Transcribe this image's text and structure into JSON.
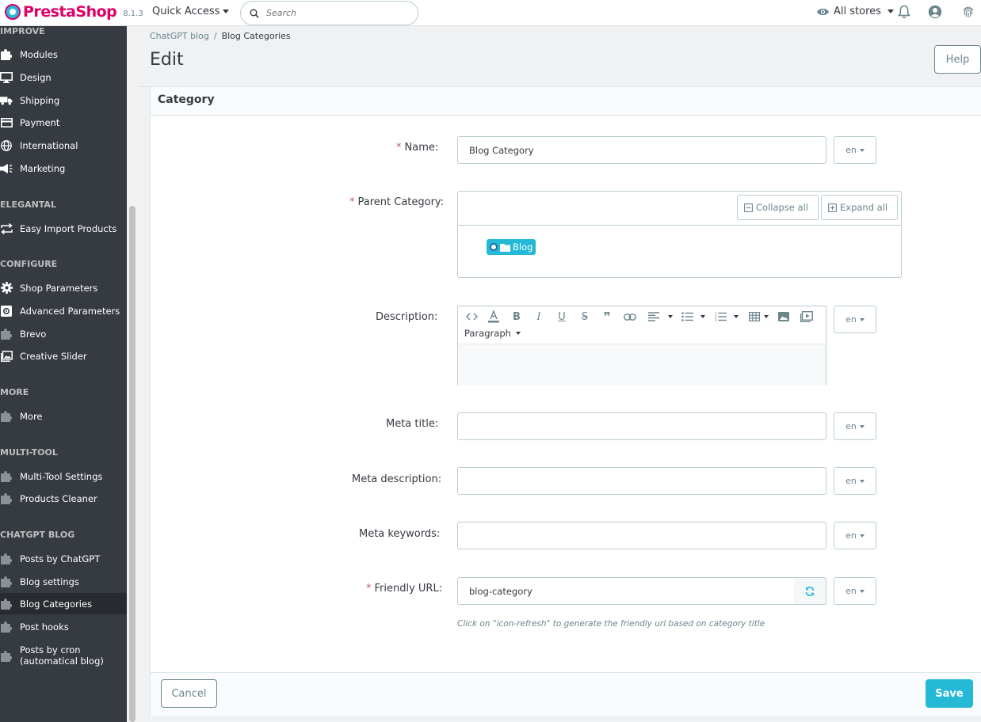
{
  "header": {
    "logo_text": "PrestaShop",
    "version": "8.1.3",
    "quick_access": "Quick Access",
    "search_placeholder": "Search",
    "all_stores": "All stores"
  },
  "sidebar": {
    "sections": {
      "improve": "IMPROVE",
      "elegantal": "ELEGANTAL",
      "configure": "CONFIGURE",
      "more": "MORE",
      "multitool": "MULTI-TOOL",
      "chatgpt": "CHATGPT BLOG"
    },
    "items": {
      "modules": "Modules",
      "design": "Design",
      "shipping": "Shipping",
      "payment": "Payment",
      "international": "International",
      "marketing": "Marketing",
      "easy_import": "Easy Import Products",
      "shop_params": "Shop Parameters",
      "advanced_params": "Advanced Parameters",
      "brevo": "Brevo",
      "creative_slider": "Creative Slider",
      "more": "More",
      "multitool_settings": "Multi-Tool Settings",
      "products_cleaner": "Products Cleaner",
      "posts_by_chatgpt": "Posts by ChatGPT",
      "blog_settings": "Blog settings",
      "blog_categories": "Blog Categories",
      "post_hooks": "Post hooks",
      "posts_by_cron_1": "Posts by cron",
      "posts_by_cron_2": "(automatical blog)"
    }
  },
  "breadcrumb": {
    "parent": "ChatGPT blog",
    "separator": "/",
    "current": "Blog Categories"
  },
  "page_title": "Edit",
  "help_label": "Help",
  "panel_title": "Category",
  "form": {
    "required_mark": "*",
    "name_label": "Name:",
    "name_value": "Blog Category",
    "parent_label": "Parent Category:",
    "collapse_all": "Collapse all",
    "expand_all": "Expand all",
    "tree_node": "Blog",
    "description_label": "Description:",
    "paragraph": "Paragraph",
    "meta_title_label": "Meta title:",
    "meta_description_label": "Meta description:",
    "meta_keywords_label": "Meta keywords:",
    "friendly_url_label": "Friendly URL:",
    "friendly_url_value": "blog-category",
    "hint": "Click on \"icon-refresh\" to generate the friendly url based on category title",
    "lang": "en"
  },
  "footer": {
    "cancel": "Cancel",
    "save": "Save"
  },
  "colors": {
    "primary": "#25b9d7",
    "brand": "#df0067",
    "sidebar_bg": "#363a41",
    "required": "#c05c67"
  }
}
